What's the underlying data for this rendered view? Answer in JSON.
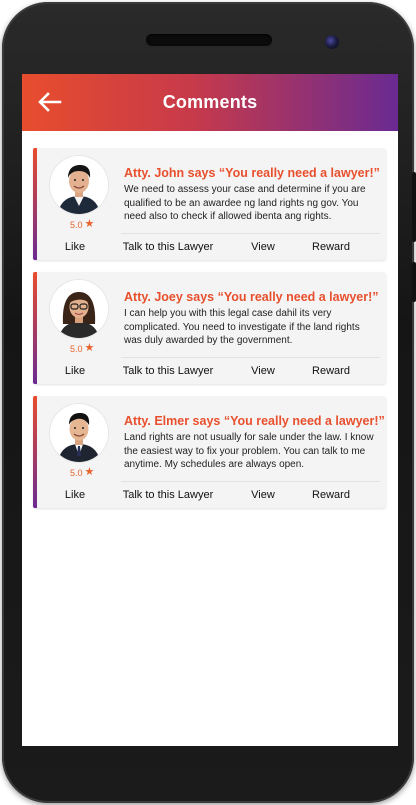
{
  "header": {
    "title": "Comments",
    "back_icon": "arrow-left-icon"
  },
  "comments": [
    {
      "title": "Atty. John says “You really need a lawyer!”",
      "body": "We need to assess your case and determine if you are qualified to be an awardee ng land rights ng gov. You need also to check if allowed ibenta ang rights.",
      "rating": "5.0",
      "actions": {
        "like": "Like",
        "talk": "Talk to this Lawyer",
        "view": "View",
        "reward": "Reward"
      }
    },
    {
      "title": "Atty. Joey says “You really need a lawyer!”",
      "body": "I can help you with this legal case dahil its very complicated. You need to investigate if the land rights was duly awarded by the government.",
      "rating": "5.0",
      "actions": {
        "like": "Like",
        "talk": "Talk to this Lawyer",
        "view": "View",
        "reward": "Reward"
      }
    },
    {
      "title": "Atty. Elmer says “You really need a lawyer!”",
      "body": "Land rights are not usually for sale under the law. I know the easiest way to fix your problem. You can talk to me anytime. My schedules are always open.",
      "rating": "5.0",
      "actions": {
        "like": "Like",
        "talk": "Talk to this Lawyer",
        "view": "View",
        "reward": "Reward"
      }
    }
  ],
  "colors": {
    "accent_orange": "#e8502d",
    "accent_purple": "#6a2a92",
    "card_bg": "#f4f4f4"
  }
}
